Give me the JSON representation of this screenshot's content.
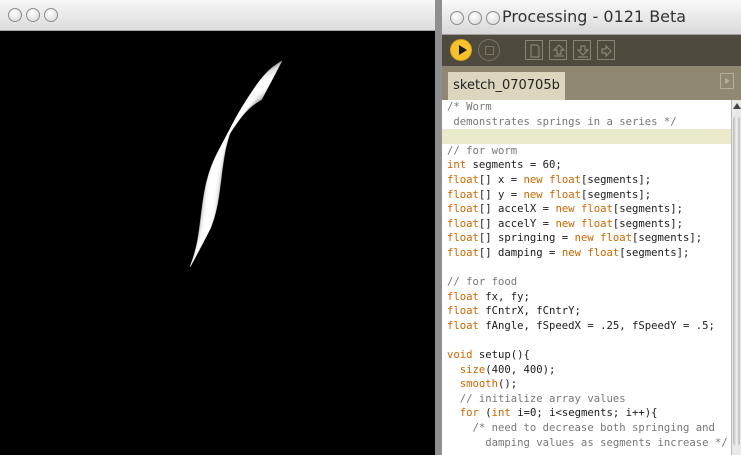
{
  "sketch_window": {
    "title": ""
  },
  "editor_window": {
    "title": "Processing - 0121 Beta"
  },
  "toolbar": {
    "buttons": [
      "run",
      "stop",
      "new",
      "open",
      "save",
      "export"
    ]
  },
  "tabs": [
    {
      "label": "sketch_070705b §"
    }
  ],
  "code": [
    [
      {
        "t": "/* Worm",
        "c": "cm"
      }
    ],
    [
      {
        "t": " demonstrates springs in a series */",
        "c": "cm"
      }
    ],
    [
      {
        "t": "",
        "c": "plain"
      }
    ],
    [
      {
        "t": "// for worm",
        "c": "cm"
      }
    ],
    [
      {
        "t": "int",
        "c": "kw"
      },
      {
        "t": " segments = 60;",
        "c": "plain"
      }
    ],
    [
      {
        "t": "float",
        "c": "kw"
      },
      {
        "t": "[] x = ",
        "c": "plain"
      },
      {
        "t": "new",
        "c": "kw"
      },
      {
        "t": " ",
        "c": "plain"
      },
      {
        "t": "float",
        "c": "kw"
      },
      {
        "t": "[segments];",
        "c": "plain"
      }
    ],
    [
      {
        "t": "float",
        "c": "kw"
      },
      {
        "t": "[] y = ",
        "c": "plain"
      },
      {
        "t": "new",
        "c": "kw"
      },
      {
        "t": " ",
        "c": "plain"
      },
      {
        "t": "float",
        "c": "kw"
      },
      {
        "t": "[segments];",
        "c": "plain"
      }
    ],
    [
      {
        "t": "float",
        "c": "kw"
      },
      {
        "t": "[] accelX = ",
        "c": "plain"
      },
      {
        "t": "new",
        "c": "kw"
      },
      {
        "t": " ",
        "c": "plain"
      },
      {
        "t": "float",
        "c": "kw"
      },
      {
        "t": "[segments];",
        "c": "plain"
      }
    ],
    [
      {
        "t": "float",
        "c": "kw"
      },
      {
        "t": "[] accelY = ",
        "c": "plain"
      },
      {
        "t": "new",
        "c": "kw"
      },
      {
        "t": " ",
        "c": "plain"
      },
      {
        "t": "float",
        "c": "kw"
      },
      {
        "t": "[segments];",
        "c": "plain"
      }
    ],
    [
      {
        "t": "float",
        "c": "kw"
      },
      {
        "t": "[] springing = ",
        "c": "plain"
      },
      {
        "t": "new",
        "c": "kw"
      },
      {
        "t": " ",
        "c": "plain"
      },
      {
        "t": "float",
        "c": "kw"
      },
      {
        "t": "[segments];",
        "c": "plain"
      }
    ],
    [
      {
        "t": "float",
        "c": "kw"
      },
      {
        "t": "[] damping = ",
        "c": "plain"
      },
      {
        "t": "new",
        "c": "kw"
      },
      {
        "t": " ",
        "c": "plain"
      },
      {
        "t": "float",
        "c": "kw"
      },
      {
        "t": "[segments];",
        "c": "plain"
      }
    ],
    [
      {
        "t": "",
        "c": "plain"
      }
    ],
    [
      {
        "t": "// for food",
        "c": "cm"
      }
    ],
    [
      {
        "t": "float",
        "c": "kw"
      },
      {
        "t": " fx, fy;",
        "c": "plain"
      }
    ],
    [
      {
        "t": "float",
        "c": "kw"
      },
      {
        "t": " fCntrX, fCntrY;",
        "c": "plain"
      }
    ],
    [
      {
        "t": "float",
        "c": "kw"
      },
      {
        "t": " fAngle, fSpeedX = .25, fSpeedY = .5;",
        "c": "plain"
      }
    ],
    [
      {
        "t": "",
        "c": "plain"
      }
    ],
    [
      {
        "t": "void",
        "c": "kw"
      },
      {
        "t": " setup(){",
        "c": "plain"
      }
    ],
    [
      {
        "t": "  ",
        "c": "plain"
      },
      {
        "t": "size",
        "c": "kw"
      },
      {
        "t": "(400, 400);",
        "c": "plain"
      }
    ],
    [
      {
        "t": "  ",
        "c": "plain"
      },
      {
        "t": "smooth",
        "c": "kw"
      },
      {
        "t": "();",
        "c": "plain"
      }
    ],
    [
      {
        "t": "  // initialize array values",
        "c": "cm"
      }
    ],
    [
      {
        "t": "  ",
        "c": "plain"
      },
      {
        "t": "for",
        "c": "kw"
      },
      {
        "t": " (",
        "c": "plain"
      },
      {
        "t": "int",
        "c": "kw"
      },
      {
        "t": " i=0; i<segments; i++){",
        "c": "plain"
      }
    ],
    [
      {
        "t": "    /* need to decrease both springing and",
        "c": "cm"
      }
    ],
    [
      {
        "t": "      damping values as segments increase */",
        "c": "cm"
      }
    ]
  ],
  "highlighted_line": 2,
  "colors": {
    "keyword": "#cc6600",
    "comment": "#777777",
    "toolbar": "#4e4a3e",
    "tabbar": "#908870",
    "run_button": "#f7c12a"
  }
}
